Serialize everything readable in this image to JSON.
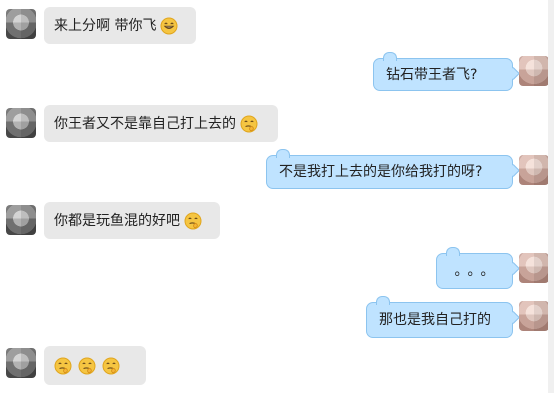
{
  "chat": {
    "messages": [
      {
        "side": "left",
        "text": "来上分啊 带你飞",
        "emoji": "grinning-face-icon"
      },
      {
        "side": "right",
        "text": "钻石带王者飞?"
      },
      {
        "side": "left",
        "text": "你王者又不是靠自己打上去的",
        "emoji": "thinking-face-icon"
      },
      {
        "side": "right",
        "text": "不是我打上去的是你给我打的呀?"
      },
      {
        "side": "left",
        "text": "你都是玩鱼混的好吧",
        "emoji": "thinking-face-icon"
      },
      {
        "side": "right",
        "text": "。。。"
      },
      {
        "side": "right",
        "text": "那也是我自己打的"
      },
      {
        "side": "left",
        "emojis": [
          "thinking-face-icon",
          "thinking-face-icon",
          "thinking-face-icon"
        ]
      }
    ]
  },
  "colors": {
    "left_bubble": "#e8e8e8",
    "right_bubble": "#bfe3ff",
    "right_border": "#8cc4ef",
    "emoji_fill": "#f5c542"
  }
}
